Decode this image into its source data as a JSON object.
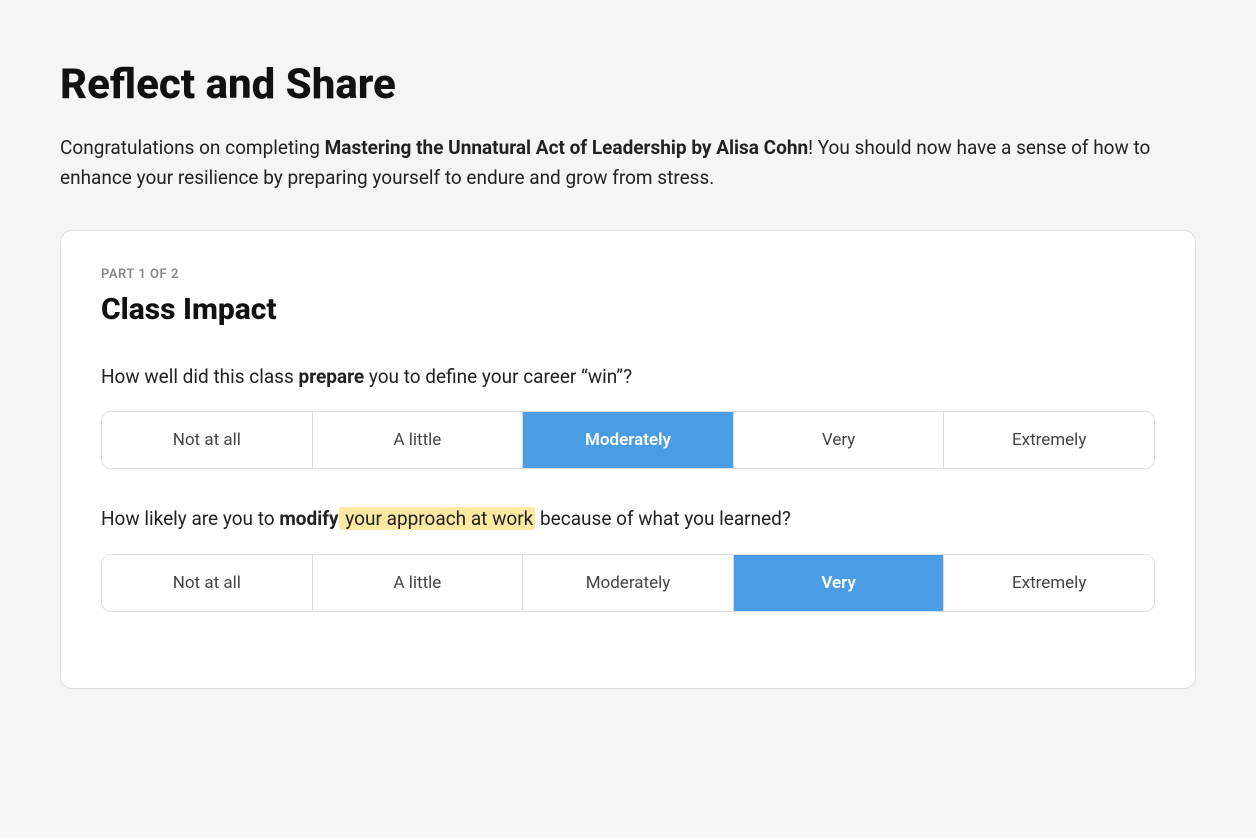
{
  "page": {
    "title": "Reflect and Share",
    "intro_normal": "Congratulations on completing ",
    "intro_bold": "Mastering the Unnatural Act of Leadership by Alisa Cohn",
    "intro_rest": "! You should now have a sense of how to enhance your resilience by preparing yourself to endure and grow from stress."
  },
  "card": {
    "part_label": "PART 1 OF 2",
    "section_title": "Class Impact",
    "questions": [
      {
        "id": "q1",
        "text_before": "How well did this class ",
        "text_bold": "prepare",
        "text_after": " you to define your career “win”?",
        "highlight": false,
        "options": [
          {
            "label": "Not at all",
            "selected": false
          },
          {
            "label": "A little",
            "selected": false
          },
          {
            "label": "Moderately",
            "selected": true
          },
          {
            "label": "Very",
            "selected": false
          },
          {
            "label": "Extremely",
            "selected": false
          }
        ]
      },
      {
        "id": "q2",
        "text_before": "How likely are you to ",
        "text_bold": "modify",
        "text_highlight": " your approach at work",
        "text_after": " because of what you learned?",
        "highlight": true,
        "options": [
          {
            "label": "Not at all",
            "selected": false
          },
          {
            "label": "A little",
            "selected": false
          },
          {
            "label": "Moderately",
            "selected": false
          },
          {
            "label": "Very",
            "selected": true
          },
          {
            "label": "Extremely",
            "selected": false
          }
        ]
      }
    ]
  }
}
